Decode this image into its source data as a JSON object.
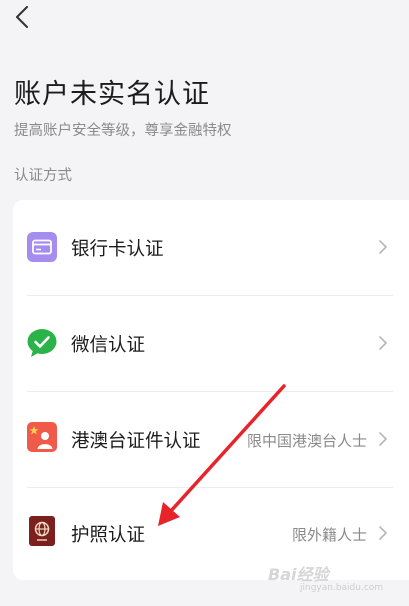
{
  "header": {
    "back_icon": "chevron-left-icon",
    "title": "账户未实名认证",
    "subtitle": "提高账户安全等级，尊享金融特权"
  },
  "section": {
    "label": "认证方式"
  },
  "methods": [
    {
      "label": "银行卡认证",
      "note": "",
      "icon": "bank-card-icon",
      "icon_color": "#a58df0"
    },
    {
      "label": "微信认证",
      "note": "",
      "icon": "wechat-icon",
      "icon_color": "#2bb34a"
    },
    {
      "label": "港澳台证件认证",
      "note": "限中国港澳台人士",
      "icon": "id-card-icon",
      "icon_color": "#ef5a4a"
    },
    {
      "label": "护照认证",
      "note": "限外籍人士",
      "icon": "passport-icon",
      "icon_color": "#7b1f1f"
    }
  ],
  "annotation": {
    "arrow_color": "#e8232a"
  },
  "watermark": {
    "text": "Bai经验",
    "sub": "jingyan.baidu.com"
  },
  "colors": {
    "background": "#f4f4f6",
    "card": "#ffffff",
    "muted_text": "#8a8a8a"
  }
}
